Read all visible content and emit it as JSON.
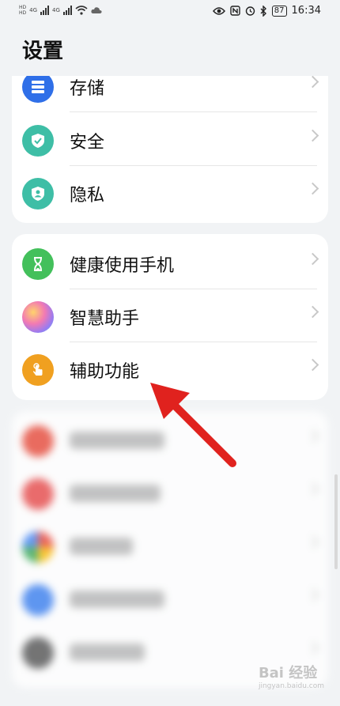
{
  "status": {
    "left_badges": [
      "HD",
      "4G",
      "4G"
    ],
    "time": "16:34",
    "battery": "87"
  },
  "page": {
    "title": "设置"
  },
  "groups": [
    {
      "items": [
        {
          "label": "存储",
          "icon": "storage-icon",
          "color": "#2f6fe8"
        },
        {
          "label": "安全",
          "icon": "shield-check-icon",
          "color": "#3ebea6"
        },
        {
          "label": "隐私",
          "icon": "privacy-shield-icon",
          "color": "#3ebea6"
        }
      ]
    },
    {
      "items": [
        {
          "label": "健康使用手机",
          "icon": "hourglass-icon",
          "color": "#43c05b"
        },
        {
          "label": "智慧助手",
          "icon": "assistant-orb-icon",
          "color": "#c86ee0"
        },
        {
          "label": "辅助功能",
          "icon": "hand-tap-icon",
          "color": "#f0a020"
        }
      ]
    },
    {
      "items": [
        {
          "label": "用户和帐户",
          "icon": "account-icon",
          "color": "#e84a3a"
        },
        {
          "label": "HMS Core",
          "icon": "hms-core-icon",
          "color": "#e84a4a"
        },
        {
          "label": "Google",
          "icon": "google-icon",
          "color": "#4285f4"
        },
        {
          "label": "系统和更新",
          "icon": "system-update-icon",
          "color": "#3a7ff0"
        },
        {
          "label": "关于手机",
          "icon": "about-phone-icon",
          "color": "#555555"
        }
      ]
    }
  ],
  "annotation": {
    "color": "#e0221e"
  },
  "watermark": {
    "text": "Bai 经验",
    "sub": "jingyan.baidu.com"
  }
}
